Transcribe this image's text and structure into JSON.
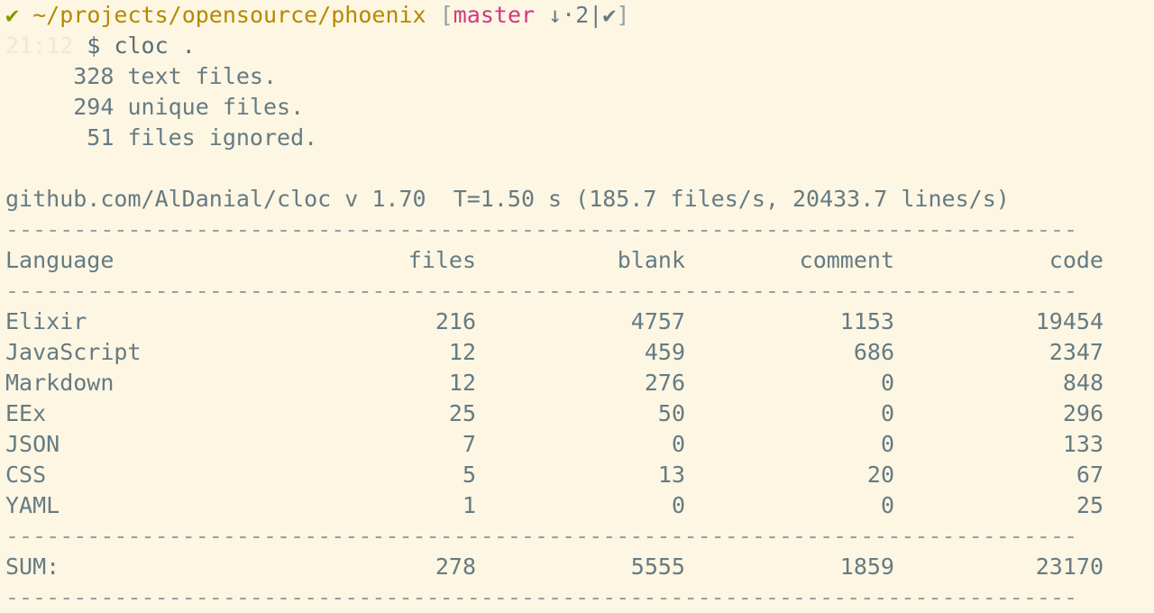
{
  "prompt": {
    "check": "✔",
    "path": "~/projects/opensource/phoenix",
    "branch": "master",
    "git_status": "↓·2|",
    "git_clean": "✔",
    "open_bracket": "[",
    "close_bracket": "]"
  },
  "command": {
    "time": "21:12",
    "symbol": "$",
    "text": "cloc ."
  },
  "summary": [
    "     328 text files.",
    "     294 unique files.",
    "      51 files ignored."
  ],
  "header_line": "github.com/AlDanial/cloc v 1.70  T=1.50 s (185.7 files/s, 20433.7 lines/s)",
  "dash_line": "-------------------------------------------------------------------------------",
  "columns": {
    "language": "Language",
    "files": "files",
    "blank": "blank",
    "comment": "comment",
    "code": "code"
  },
  "rows": [
    {
      "language": "Elixir",
      "files": "216",
      "blank": "4757",
      "comment": "1153",
      "code": "19454"
    },
    {
      "language": "JavaScript",
      "files": "12",
      "blank": "459",
      "comment": "686",
      "code": "2347"
    },
    {
      "language": "Markdown",
      "files": "12",
      "blank": "276",
      "comment": "0",
      "code": "848"
    },
    {
      "language": "EEx",
      "files": "25",
      "blank": "50",
      "comment": "0",
      "code": "296"
    },
    {
      "language": "JSON",
      "files": "7",
      "blank": "0",
      "comment": "0",
      "code": "133"
    },
    {
      "language": "CSS",
      "files": "5",
      "blank": "13",
      "comment": "20",
      "code": "67"
    },
    {
      "language": "YAML",
      "files": "1",
      "blank": "0",
      "comment": "0",
      "code": "25"
    }
  ],
  "sum": {
    "language": "SUM:",
    "files": "278",
    "blank": "5555",
    "comment": "1859",
    "code": "23170"
  },
  "colors": {
    "background": "#fdf6e3",
    "check": "#859900",
    "path": "#b58900",
    "branch": "#d33682",
    "text": "#657b83"
  }
}
